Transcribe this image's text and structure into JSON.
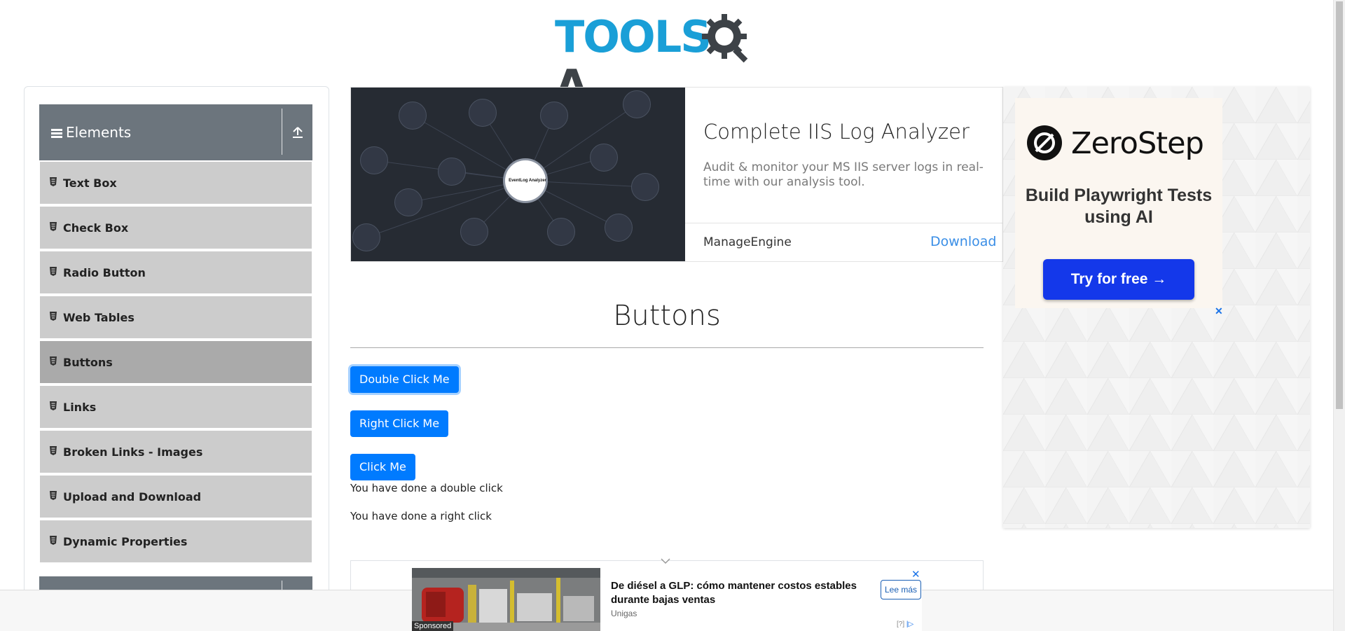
{
  "header": {
    "logo_text_blue": "TOOLS",
    "logo_text_dark": "A",
    "logo_gear_letter": "Q"
  },
  "sidebar": {
    "group_title": "Elements",
    "items": [
      {
        "label": "Text Box"
      },
      {
        "label": "Check Box"
      },
      {
        "label": "Radio Button"
      },
      {
        "label": "Web Tables"
      },
      {
        "label": "Buttons",
        "active": true
      },
      {
        "label": "Links"
      },
      {
        "label": "Broken Links - Images"
      },
      {
        "label": "Upload and Download"
      },
      {
        "label": "Dynamic Properties"
      }
    ]
  },
  "ad_top": {
    "title": "Complete IIS Log Analyzer",
    "description": "Audit & monitor your MS IIS server logs in real-time with our analysis tool.",
    "brand": "ManageEngine",
    "cta": "Download",
    "center_label": "EventLog Analyzer",
    "center_brand": "ManageEngine"
  },
  "main": {
    "heading": "Buttons",
    "double_click_label": "Double Click Me",
    "right_click_label": "Right Click Me",
    "click_label": "Click Me",
    "double_click_message": "You have done a double click",
    "right_click_message": "You have done a right click"
  },
  "ad_right": {
    "brand": "ZeroStep",
    "tagline": "Build Playwright Tests using AI",
    "cta": "Try for free →",
    "close": "✕"
  },
  "sticky_ad": {
    "title": "De diésel a GLP: cómo mantener costos estables durante bajas ventas",
    "brand": "Unigas",
    "cta": "Lee más",
    "sponsored": "Sponsored",
    "close": "✕",
    "info": "[?]"
  },
  "colors": {
    "primary": "#007bff",
    "logo_blue": "#1a9fd7",
    "logo_dark": "#3d4247",
    "sidebar_header": "#6c757d",
    "sidebar_item": "#cccccc",
    "sidebar_item_active": "#aaaaaa"
  }
}
